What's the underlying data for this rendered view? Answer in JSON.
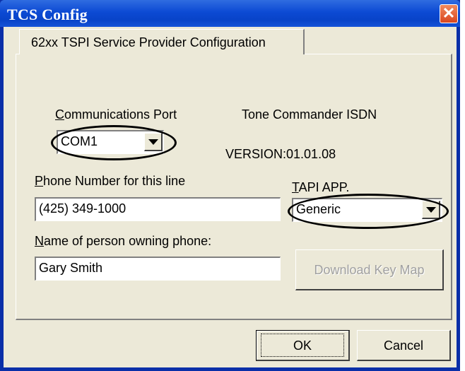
{
  "window": {
    "title": "TCS Config"
  },
  "tab": {
    "label": "62xx TSPI Service Provider Configuration"
  },
  "fields": {
    "comm_port": {
      "label_underline": "C",
      "label_rest": "ommunications Port",
      "value": "COM1"
    },
    "product_name": "Tone Commander ISDN",
    "version": "VERSION:01.01.08",
    "phone_number": {
      "label_underline": "P",
      "label_rest": "hone Number for this line",
      "value": "(425) 349-1000"
    },
    "tapi_app": {
      "label_underline": "T",
      "label_rest": "API APP.",
      "value": "Generic"
    },
    "owner_name": {
      "label_underline": "N",
      "label_rest": "ame of person owning phone:",
      "value": "Gary Smith"
    }
  },
  "buttons": {
    "download_key_map": "Download Key Map",
    "ok": "OK",
    "cancel": "Cancel"
  },
  "icons": {
    "close": "close-icon",
    "dropdown": "chevron-down-icon"
  },
  "colors": {
    "titlebar": "#0c4ad4",
    "dialog_face": "#ece9d8",
    "close_button": "#d9461f"
  }
}
